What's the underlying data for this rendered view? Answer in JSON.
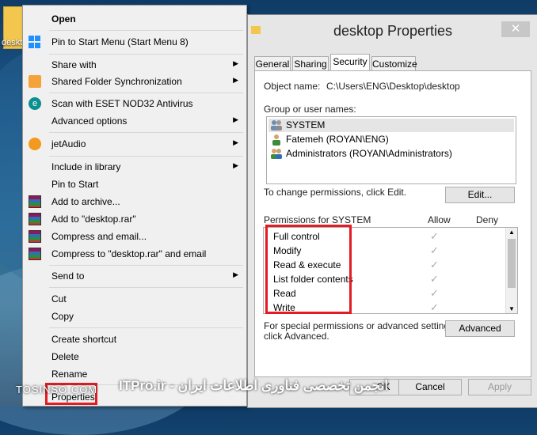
{
  "desktop": {
    "icon_label": "deskt"
  },
  "context_menu": {
    "items": [
      {
        "label": "Open",
        "bold": true
      },
      {
        "label": "Pin to Start Menu (Start Menu 8)"
      },
      {
        "label": "Share with"
      },
      {
        "label": "Shared Folder Synchronization"
      },
      {
        "label": "Scan with ESET NOD32 Antivirus"
      },
      {
        "label": "Advanced options"
      },
      {
        "label": "jetAudio"
      },
      {
        "label": "Include in library"
      },
      {
        "label": "Pin to Start"
      },
      {
        "label": "Add to archive..."
      },
      {
        "label": "Add to \"desktop.rar\""
      },
      {
        "label": "Compress and email..."
      },
      {
        "label": "Compress to \"desktop.rar\" and email"
      },
      {
        "label": "Send to"
      },
      {
        "label": "Cut"
      },
      {
        "label": "Copy"
      },
      {
        "label": "Create shortcut"
      },
      {
        "label": "Delete"
      },
      {
        "label": "Rename"
      },
      {
        "label": "Properties"
      }
    ],
    "submenu_arrow": "▶"
  },
  "properties": {
    "title": "desktop Properties",
    "close_glyph": "✕",
    "tabs": [
      "General",
      "Sharing",
      "Security",
      "Customize"
    ],
    "active_tab": "Security",
    "object_name_label": "Object name:",
    "object_name_value": "C:\\Users\\ENG\\Desktop\\desktop",
    "group_label": "Group or user names:",
    "users": [
      "SYSTEM",
      "Fatemeh (ROYAN\\ENG)",
      "Administrators (ROYAN\\Administrators)"
    ],
    "change_text": "To change permissions, click Edit.",
    "edit_button": "Edit...",
    "permissions_for": "Permissions for SYSTEM",
    "allow_header": "Allow",
    "deny_header": "Deny",
    "permissions": [
      "Full control",
      "Modify",
      "Read & execute",
      "List folder contents",
      "Read",
      "Write"
    ],
    "check_glyph": "✓",
    "special_text_1": "For special permissions or advanced settings,",
    "special_text_2": "click Advanced.",
    "advanced_button": "Advanced",
    "ok_button": "OK",
    "cancel_button": "Cancel",
    "apply_button": "Apply"
  },
  "watermarks": {
    "left": "TOSINSO.COM",
    "right": "ITPro.ir - انجمن تخصصی فناوری اطلاعات ایران"
  },
  "colors": {
    "highlight": "#e31b23",
    "menu_bg": "#f0f0f0",
    "window_bg": "#e6e6e6"
  }
}
